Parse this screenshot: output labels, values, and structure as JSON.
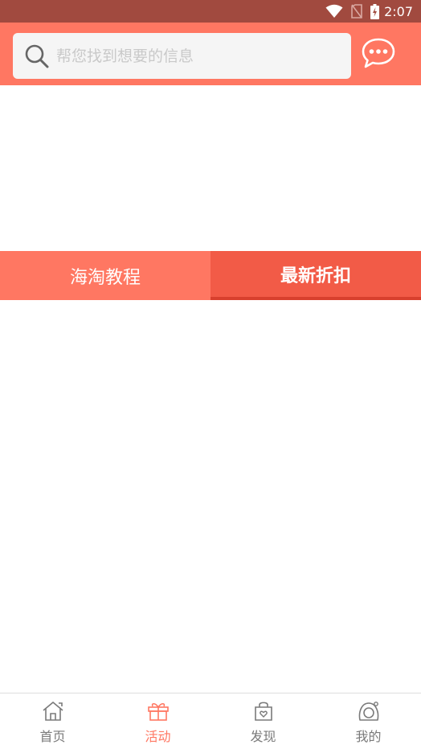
{
  "status_bar": {
    "time": "2:07",
    "icons": [
      "wifi-icon",
      "no-sim-icon",
      "battery-charging-icon"
    ]
  },
  "search": {
    "placeholder": "帮您找到想要的信息",
    "value": "",
    "icon": "search-icon"
  },
  "header": {
    "message_icon": "chat-bubble-icon"
  },
  "tabs": [
    {
      "label": "海淘教程",
      "active": false
    },
    {
      "label": "最新折扣",
      "active": true
    }
  ],
  "bottom_nav": {
    "items": [
      {
        "label": "首页",
        "icon": "home-icon",
        "active": false
      },
      {
        "label": "活动",
        "icon": "gift-icon",
        "active": true
      },
      {
        "label": "发现",
        "icon": "shopping-bag-icon",
        "active": false
      },
      {
        "label": "我的",
        "icon": "user-icon",
        "active": false
      }
    ]
  },
  "colors": {
    "header": "#ff7762",
    "status_bar": "#a14a3f",
    "tab_active": "#f25b47",
    "tab_indicator": "#d8402e",
    "nav_active": "#ff7762",
    "nav_inactive": "#7a7a7a"
  }
}
